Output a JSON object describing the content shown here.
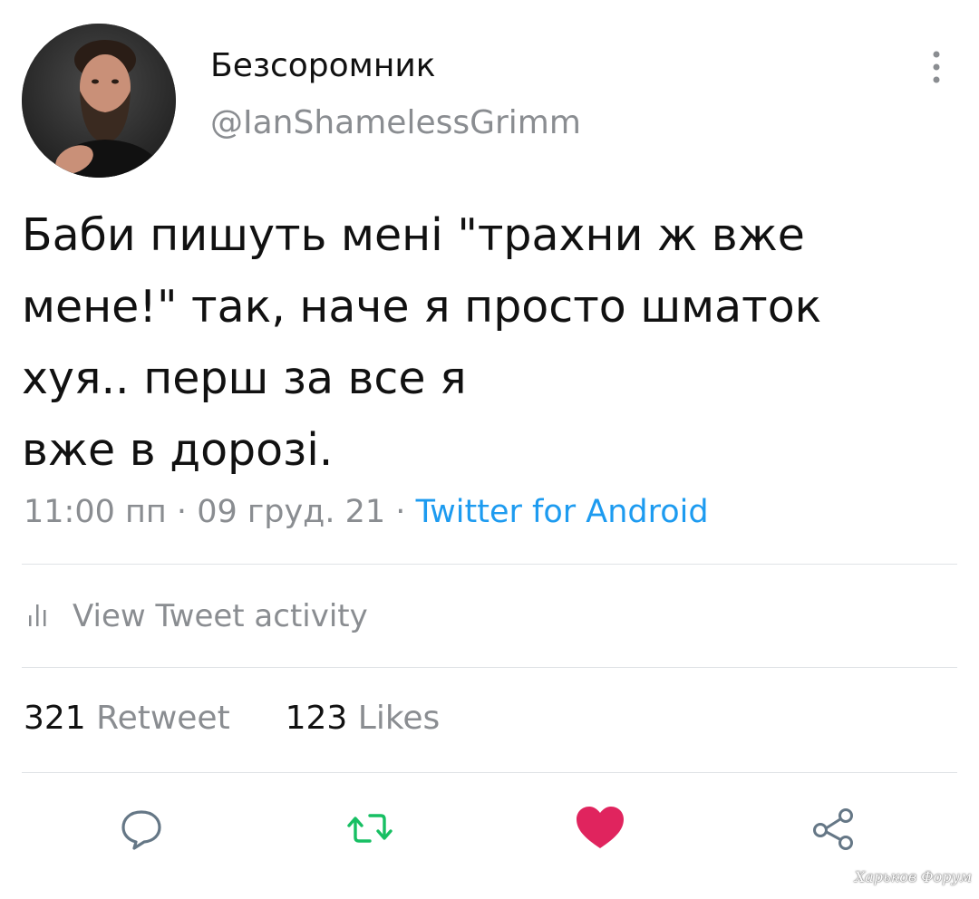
{
  "user": {
    "display_name": "Безсоромник",
    "handle": "@IanShamelessGrimm",
    "avatar_icon": "profile-photo"
  },
  "tweet": {
    "text": "Баби пишуть мені \"трахни ж вже\nмене!\" так, наче я просто шматок\nхуя.. перш за все я\nвже в дорозі.",
    "time": "11:00 пп",
    "date": "09 груд. 21",
    "separator": "·",
    "source": "Twitter for Android"
  },
  "activity": {
    "label": "View Tweet activity",
    "icon": "bar-chart-icon"
  },
  "counts": {
    "retweets_num": "321",
    "retweets_label": "Retweet",
    "likes_num": "123",
    "likes_label": "Likes"
  },
  "actions": [
    {
      "name": "reply",
      "icon": "comment-icon",
      "color": "#657786"
    },
    {
      "name": "retweet",
      "icon": "retweet-icon",
      "color": "#17bf63"
    },
    {
      "name": "like",
      "icon": "heart-icon",
      "color": "#e0245e"
    },
    {
      "name": "share",
      "icon": "share-icon",
      "color": "#657786"
    }
  ],
  "watermark": "Харьков Форум",
  "colors": {
    "accent": "#1d9bf0",
    "retweet": "#17bf63",
    "like": "#e0245e",
    "secondary_text": "#8a8d91"
  }
}
